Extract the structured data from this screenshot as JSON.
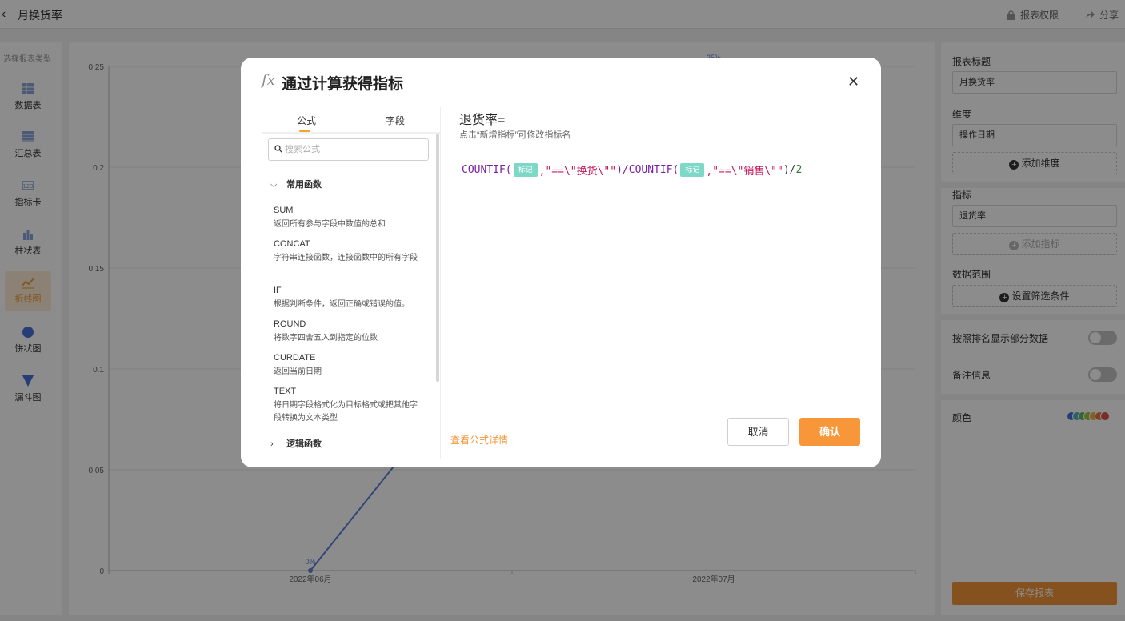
{
  "topbar": {
    "title": "月换货率",
    "permissions": "报表权限",
    "share": "分享"
  },
  "sidebar": {
    "hint": "选择报表类型",
    "types": [
      {
        "label": "数据表",
        "icon": "table-icon"
      },
      {
        "label": "汇总表",
        "icon": "summary-table-icon"
      },
      {
        "label": "指标卡",
        "icon": "metric-card-icon"
      },
      {
        "label": "柱状表",
        "icon": "bar-chart-icon"
      },
      {
        "label": "折线图",
        "icon": "line-chart-icon",
        "active": true
      },
      {
        "label": "饼状图",
        "icon": "pie-chart-icon"
      },
      {
        "label": "漏斗图",
        "icon": "funnel-icon"
      }
    ]
  },
  "chart_data": {
    "type": "line",
    "categories": [
      "2022年06月",
      "2022年07月"
    ],
    "y_ticks": [
      "0",
      "0.05",
      "0.1",
      "0.15",
      "0.2",
      "0.25"
    ],
    "ylim": [
      0,
      0.25
    ],
    "series": [
      {
        "values": [
          0,
          0.25
        ]
      }
    ],
    "data_labels": [
      "0%",
      "25%"
    ],
    "grid": true
  },
  "panel": {
    "title_label": "报表标题",
    "title_value": "月换货率",
    "dimension_label": "维度",
    "dimension_value": "操作日期",
    "add_dimension": "添加维度",
    "metric_label": "指标",
    "metric_value": "退货率",
    "add_metric": "添加指标",
    "range_label": "数据范围",
    "set_filter": "设置筛选条件",
    "rank_label": "按照排名显示部分数据",
    "note_label": "备注信息",
    "color_label": "颜色",
    "colors": [
      "#4a6fd6",
      "#4fb0c6",
      "#5cb85c",
      "#9bc53d",
      "#f0ad4e",
      "#e8743b",
      "#d9534f"
    ],
    "save": "保存报表"
  },
  "modal": {
    "fx": "fx",
    "title": "通过计算获得指标",
    "tabs": {
      "formula": "公式",
      "field": "字段"
    },
    "search_placeholder": "搜索公式",
    "groups": {
      "common": "常用函数",
      "logic": "逻辑函数"
    },
    "functions": [
      {
        "name": "SUM",
        "desc": "返回所有参与字段中数值的总和"
      },
      {
        "name": "CONCAT",
        "desc": "字符串连接函数，连接函数中的所有字段"
      },
      {
        "name": "IF",
        "desc": "根据判断条件，返回正确或错误的值。"
      },
      {
        "name": "ROUND",
        "desc": "将数字四舍五入到指定的位数"
      },
      {
        "name": "CURDATE",
        "desc": "返回当前日期"
      },
      {
        "name": "TEXT",
        "desc": "将日期字段格式化为目标格式或把其他字段转换为文本类型"
      }
    ],
    "metric_name": "退货率=",
    "metric_hint": "点击“新增指标”可修改指标名",
    "formula": {
      "fn1": "COUNTIF(",
      "tag1": "标记",
      "str1": ",\"==\\\"换货\\\"\"",
      "mid": ")/COUNTIF(",
      "tag2": "标记",
      "str2": ",\"==\\\"销售\\\"\"",
      "end_op": ")/",
      "end_num": "2"
    },
    "detail_link": "查看公式详情",
    "cancel": "取消",
    "confirm": "确认"
  }
}
